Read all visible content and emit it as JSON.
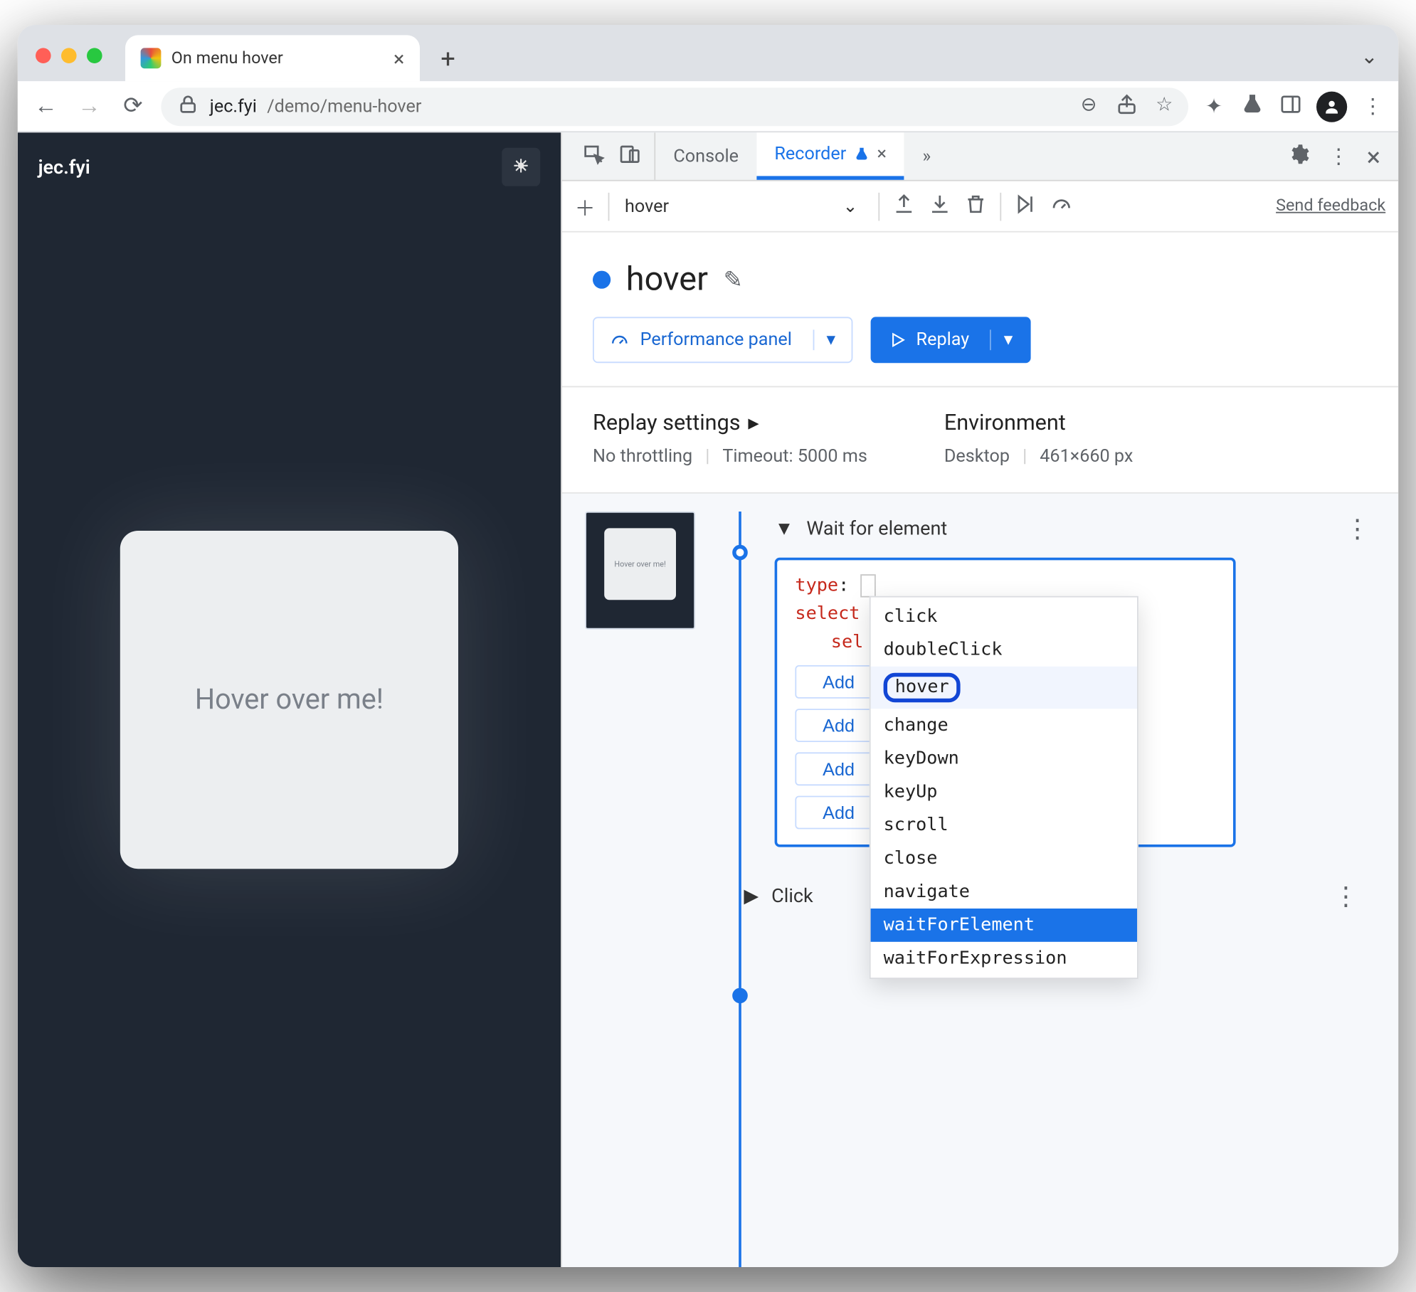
{
  "browser": {
    "tab_title": "On menu hover",
    "url_domain": "jec.fyi",
    "url_path": "/demo/menu-hover"
  },
  "page": {
    "site_title": "jec.fyi",
    "card_text": "Hover over me!"
  },
  "devtools": {
    "tab_console": "Console",
    "tab_recorder": "Recorder",
    "feedback": "Send feedback"
  },
  "recorder": {
    "recording_name": "hover",
    "title": "hover",
    "perf_button": "Performance panel",
    "replay_button": "Replay",
    "replay_settings_label": "Replay settings",
    "no_throttling": "No throttling",
    "timeout": "Timeout: 5000 ms",
    "environment_label": "Environment",
    "env_device": "Desktop",
    "env_size": "461×660 px"
  },
  "step": {
    "title": "Wait for element",
    "type_key": "type",
    "selector_key_prefix": "select",
    "sel_prefix": "sel",
    "add_label": "Add",
    "thumb_text": "Hover over me!"
  },
  "dropdown": {
    "options": {
      "click": "click",
      "doubleClick": "doubleClick",
      "hover": "hover",
      "change": "change",
      "keyDown": "keyDown",
      "keyUp": "keyUp",
      "scroll": "scroll",
      "close": "close",
      "navigate": "navigate",
      "waitForElement": "waitForElement",
      "waitForExpression": "waitForExpression"
    }
  },
  "step2": {
    "title": "Click"
  }
}
